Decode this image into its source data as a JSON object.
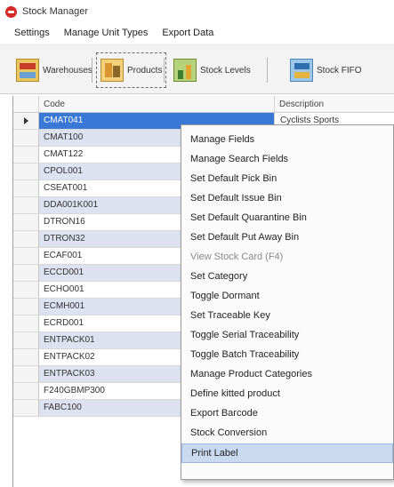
{
  "window": {
    "title": "Stock Manager"
  },
  "menubar": {
    "items": [
      "Settings",
      "Manage Unit Types",
      "Export Data"
    ]
  },
  "toolbar": {
    "buttons": [
      {
        "label": "Warehouses",
        "icon": "warehouse-icon"
      },
      {
        "label": "Products",
        "icon": "products-icon",
        "active": true
      },
      {
        "label": "Stock Levels",
        "icon": "stock-levels-icon"
      },
      {
        "label": "Stock FIFO",
        "icon": "stock-fifo-icon"
      }
    ]
  },
  "grid": {
    "columns": [
      "Code",
      "Description"
    ],
    "rows": [
      {
        "code": "CMAT041",
        "description": "Cyclists Sports"
      },
      {
        "code": "CMAT100",
        "description": ""
      },
      {
        "code": "CMAT122",
        "description": ""
      },
      {
        "code": "CPOL001",
        "description": ""
      },
      {
        "code": "CSEAT001",
        "description": ""
      },
      {
        "code": "DDA001K001",
        "description": ""
      },
      {
        "code": "DTRON16",
        "description": ""
      },
      {
        "code": "DTRON32",
        "description": ""
      },
      {
        "code": "ECAF001",
        "description": ""
      },
      {
        "code": "ECCD001",
        "description": ""
      },
      {
        "code": "ECHO001",
        "description": ""
      },
      {
        "code": "ECMH001",
        "description": ""
      },
      {
        "code": "ECRD001",
        "description": ""
      },
      {
        "code": "ENTPACK01",
        "description": ""
      },
      {
        "code": "ENTPACK02",
        "description": ""
      },
      {
        "code": "ENTPACK03",
        "description": ""
      },
      {
        "code": "F240GBMP300",
        "description": ""
      },
      {
        "code": "FABC100",
        "description": ""
      }
    ]
  },
  "context_menu": {
    "items": [
      {
        "label": "Manage Fields",
        "disabled": false
      },
      {
        "label": "Manage Search Fields",
        "disabled": false
      },
      {
        "label": "Set Default Pick Bin",
        "disabled": false
      },
      {
        "label": "Set Default Issue Bin",
        "disabled": false
      },
      {
        "label": "Set Default Quarantine Bin",
        "disabled": false
      },
      {
        "label": "Set Default Put Away Bin",
        "disabled": false
      },
      {
        "label": "View Stock Card (F4)",
        "disabled": true
      },
      {
        "label": "Set Category",
        "disabled": false
      },
      {
        "label": "Toggle Dormant",
        "disabled": false
      },
      {
        "label": "Set Traceable Key",
        "disabled": false
      },
      {
        "label": "Toggle Serial Traceability",
        "disabled": false
      },
      {
        "label": "Toggle Batch Traceability",
        "disabled": false
      },
      {
        "label": "Manage Product Categories",
        "disabled": false
      },
      {
        "label": "Define kitted product",
        "disabled": false
      },
      {
        "label": "Export Barcode",
        "disabled": false
      },
      {
        "label": "Stock Conversion",
        "disabled": false
      },
      {
        "label": "Print Label",
        "disabled": false,
        "highlighted": true
      }
    ]
  }
}
